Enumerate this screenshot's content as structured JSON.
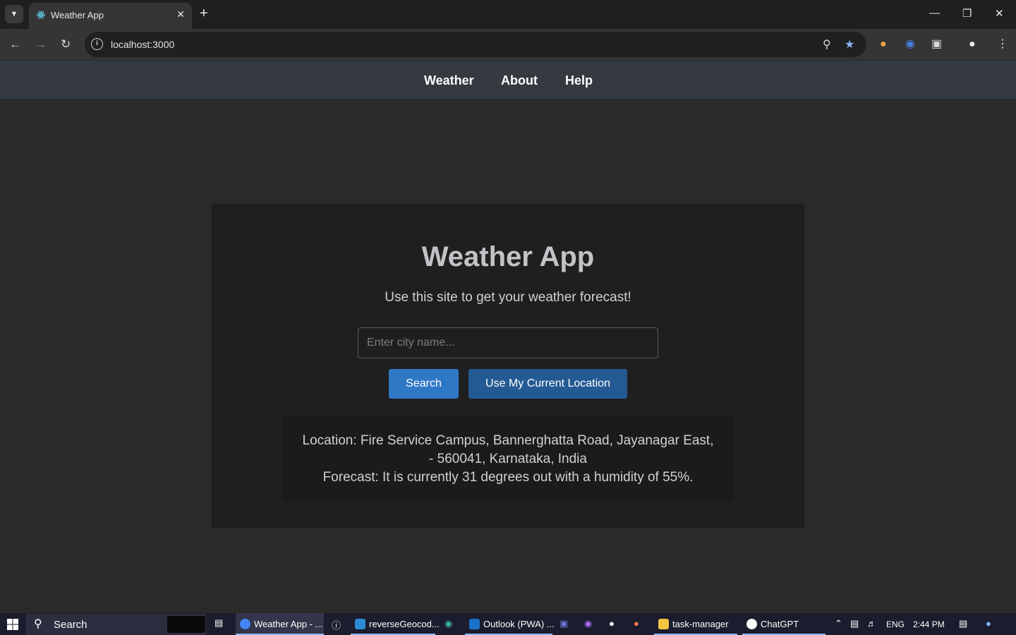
{
  "browser": {
    "tab_title": "Weather App",
    "url": "localhost:3000"
  },
  "site_nav": {
    "items": [
      "Weather",
      "About",
      "Help"
    ]
  },
  "main": {
    "title": "Weather App",
    "subtitle": "Use this site to get your weather forecast!",
    "city_placeholder": "Enter city name...",
    "search_label": "Search",
    "location_label": "Use My Current Location",
    "location_text": "Location: Fire Service Campus, Bannerghatta Road, Jayanagar East, - 560041, Karnataka, India",
    "forecast_text": "Forecast: It is currently 31 degrees out with a humidity of 55%."
  },
  "taskbar": {
    "search_label": "Search",
    "apps": [
      {
        "label": "Weather App - ..."
      },
      {
        "label": "reverseGeocod..."
      },
      {
        "label": "Outlook (PWA) ..."
      },
      {
        "label": "task-manager"
      },
      {
        "label": "ChatGPT"
      }
    ],
    "lang": "ENG",
    "time": "2:44 PM"
  },
  "colors": {
    "nav_bg": "#343a40",
    "card_bg": "#1f1f20",
    "search_btn": "#2f78c6",
    "location_btn": "#245a93"
  }
}
